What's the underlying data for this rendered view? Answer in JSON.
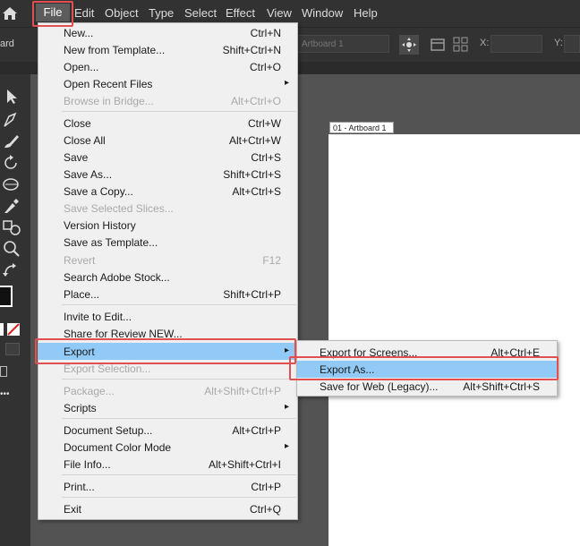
{
  "menubar": {
    "items": [
      "File",
      "Edit",
      "Object",
      "Type",
      "Select",
      "Effect",
      "View",
      "Window",
      "Help"
    ]
  },
  "controlbar": {
    "workspace_label": "ard",
    "artboard_field": "Artboard 1",
    "x_label": "X:",
    "y_label": "Y:"
  },
  "canvas": {
    "artboard_label": "01 - Artboard 1"
  },
  "file_menu": {
    "items": [
      {
        "label": "New...",
        "shortcut": "Ctrl+N"
      },
      {
        "label": "New from Template...",
        "shortcut": "Shift+Ctrl+N"
      },
      {
        "label": "Open...",
        "shortcut": "Ctrl+O"
      },
      {
        "label": "Open Recent Files",
        "shortcut": ""
      },
      {
        "label": "Browse in Bridge...",
        "shortcut": "Alt+Ctrl+O"
      },
      {
        "label": "Close",
        "shortcut": "Ctrl+W"
      },
      {
        "label": "Close All",
        "shortcut": "Alt+Ctrl+W"
      },
      {
        "label": "Save",
        "shortcut": "Ctrl+S"
      },
      {
        "label": "Save As...",
        "shortcut": "Shift+Ctrl+S"
      },
      {
        "label": "Save a Copy...",
        "shortcut": "Alt+Ctrl+S"
      },
      {
        "label": "Save Selected Slices...",
        "shortcut": ""
      },
      {
        "label": "Version History",
        "shortcut": ""
      },
      {
        "label": "Save as Template...",
        "shortcut": ""
      },
      {
        "label": "Revert",
        "shortcut": "F12"
      },
      {
        "label": "Search Adobe Stock...",
        "shortcut": ""
      },
      {
        "label": "Place...",
        "shortcut": "Shift+Ctrl+P"
      },
      {
        "label": "Invite to Edit...",
        "shortcut": ""
      },
      {
        "label": "Share for Review NEW...",
        "shortcut": ""
      },
      {
        "label": "Export",
        "shortcut": ""
      },
      {
        "label": "Export Selection...",
        "shortcut": ""
      },
      {
        "label": "Package...",
        "shortcut": "Alt+Shift+Ctrl+P"
      },
      {
        "label": "Scripts",
        "shortcut": ""
      },
      {
        "label": "Document Setup...",
        "shortcut": "Alt+Ctrl+P"
      },
      {
        "label": "Document Color Mode",
        "shortcut": ""
      },
      {
        "label": "File Info...",
        "shortcut": "Alt+Shift+Ctrl+I"
      },
      {
        "label": "Print...",
        "shortcut": "Ctrl+P"
      },
      {
        "label": "Exit",
        "shortcut": "Ctrl+Q"
      }
    ]
  },
  "export_submenu": {
    "items": [
      {
        "label": "Export for Screens...",
        "shortcut": "Alt+Ctrl+E"
      },
      {
        "label": "Export As...",
        "shortcut": ""
      },
      {
        "label": "Save for Web (Legacy)...",
        "shortcut": "Alt+Shift+Ctrl+S"
      }
    ]
  },
  "colors": {
    "highlight": "#91c9f7",
    "callout": "#e14f4f",
    "menu_bg": "#f0f0f0",
    "app_bg": "#323232"
  },
  "icons": [
    "home-icon",
    "selection-tool-icon",
    "pen-tool-icon",
    "paintbrush-icon",
    "rotate-icon",
    "shape-builder-icon",
    "eyedropper-icon",
    "blend-icon",
    "zoom-icon",
    "swap-colors-icon",
    "artboard-options-icon"
  ]
}
